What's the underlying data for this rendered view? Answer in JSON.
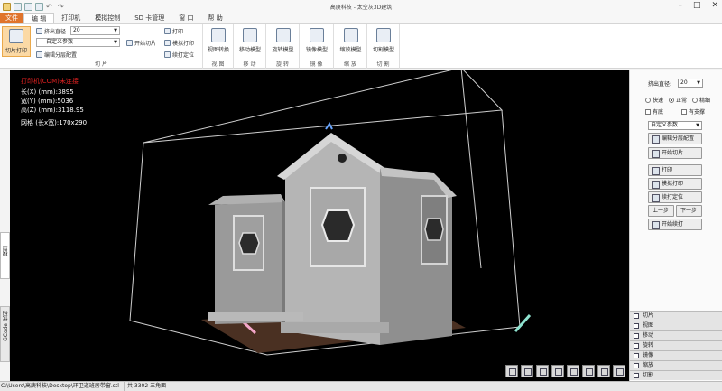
{
  "window": {
    "title": "高庚科技 - 太空灰3D建筑"
  },
  "menu": {
    "items": [
      "文件",
      "编 辑",
      "打印机",
      "模拟控制",
      "SD 卡管理",
      "窗 口",
      "帮 助"
    ]
  },
  "ribbon": {
    "slice_print_label": "切片打印",
    "nozzle_label": "挤出直径",
    "nozzle_value": "20",
    "custom_params": "自定义参数",
    "edit_config": "编辑分层配置",
    "start_slice": "开始切片",
    "print": "打印",
    "sim_print": "模拟打印",
    "resume_pos": "续打定位",
    "group_slice": "切 片",
    "view_convert": "视图转换",
    "group_view": "视 图",
    "move_model": "移动模型",
    "group_move": "移 动",
    "rotate_model": "旋转模型",
    "group_rotate": "旋 转",
    "mirror_model": "镜像模型",
    "group_mirror": "镜 像",
    "scale_model": "缩放模型",
    "group_scale": "缩 放",
    "cut_model": "切割模型",
    "group_cut": "切 割"
  },
  "viewport": {
    "status": "打印机(COM)未连接",
    "length": "长(X) (mm):3895",
    "width": "宽(Y) (mm):5036",
    "height": "高(Z) (mm):3118.95",
    "grid": "网格 (长x宽):170x290"
  },
  "left_tabs": {
    "model": "模型",
    "gcode": "GCode 代码"
  },
  "right_panel": {
    "nozzle_label": "挤出直径:",
    "nozzle_value": "20",
    "speed_fast": "快速",
    "speed_normal": "正常",
    "speed_fine": "精细",
    "with_shell": "有底",
    "with_support": "有支撑",
    "custom_params": "自定义参数",
    "edit_config": "编辑分层配置",
    "start_slice": "开始切片",
    "print": "打印",
    "sim_print": "模拟打印",
    "resume_pos": "续打定位",
    "prev_step": "上一步",
    "next_step": "下一步",
    "start_resume": "开始续打",
    "accordion": [
      "切片",
      "视图",
      "移动",
      "旋转",
      "镜像",
      "缩放",
      "切割"
    ]
  },
  "status_bar": {
    "path": "C:\\Users\\高庚科技\\Desktop\\环卫道班房带窗.stl",
    "triangles": "共 3302 三角面"
  },
  "colors": {
    "accent": "#e0742c",
    "background": "#000000",
    "selected": "#fbd9a5"
  }
}
